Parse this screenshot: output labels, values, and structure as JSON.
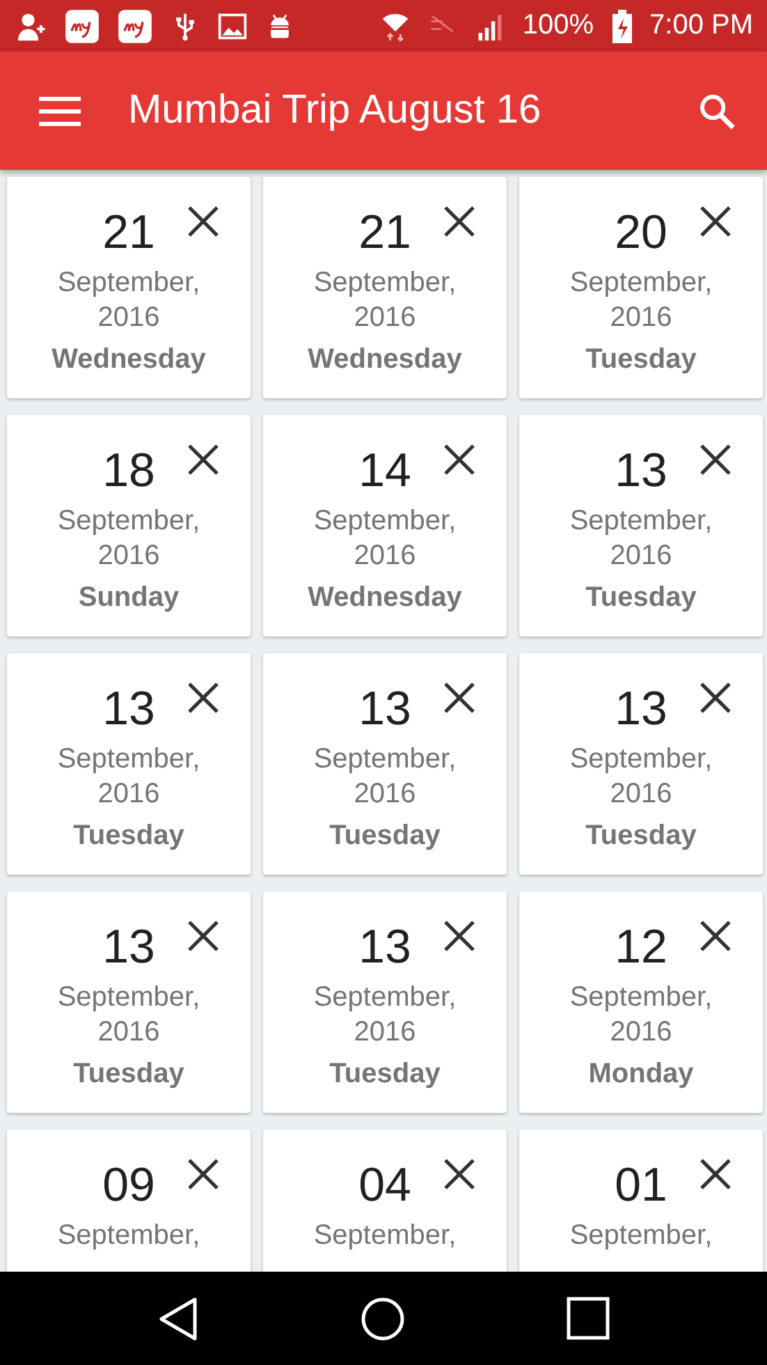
{
  "status_bar": {
    "battery": "100%",
    "time": "7:00 PM"
  },
  "app_bar": {
    "title": "Mumbai Trip August 16"
  },
  "dates": [
    {
      "day": "21",
      "month": "September,",
      "year": "2016",
      "weekday": "Wednesday"
    },
    {
      "day": "21",
      "month": "September,",
      "year": "2016",
      "weekday": "Wednesday"
    },
    {
      "day": "20",
      "month": "September,",
      "year": "2016",
      "weekday": "Tuesday"
    },
    {
      "day": "18",
      "month": "September,",
      "year": "2016",
      "weekday": "Sunday"
    },
    {
      "day": "14",
      "month": "September,",
      "year": "2016",
      "weekday": "Wednesday"
    },
    {
      "day": "13",
      "month": "September,",
      "year": "2016",
      "weekday": "Tuesday"
    },
    {
      "day": "13",
      "month": "September,",
      "year": "2016",
      "weekday": "Tuesday"
    },
    {
      "day": "13",
      "month": "September,",
      "year": "2016",
      "weekday": "Tuesday"
    },
    {
      "day": "13",
      "month": "September,",
      "year": "2016",
      "weekday": "Tuesday"
    },
    {
      "day": "13",
      "month": "September,",
      "year": "2016",
      "weekday": "Tuesday"
    },
    {
      "day": "13",
      "month": "September,",
      "year": "2016",
      "weekday": "Tuesday"
    },
    {
      "day": "12",
      "month": "September,",
      "year": "2016",
      "weekday": "Monday"
    },
    {
      "day": "09",
      "month": "September,"
    },
    {
      "day": "04",
      "month": "September,"
    },
    {
      "day": "01",
      "month": "September,"
    }
  ]
}
